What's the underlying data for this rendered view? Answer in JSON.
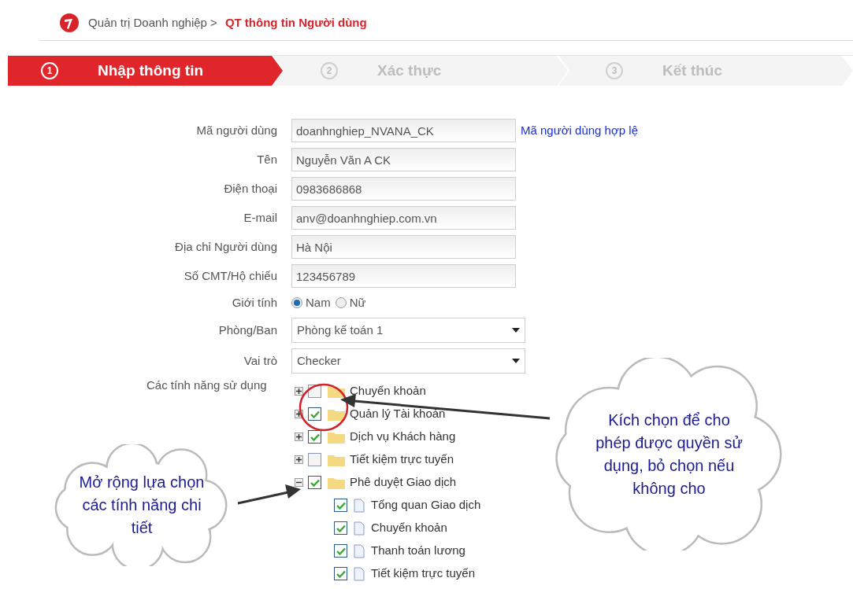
{
  "breadcrumb": {
    "parent": "Quản trị Doanh nghiệp >",
    "current": "QT thông tin Người dùng"
  },
  "steps": [
    {
      "number": "1",
      "label": "Nhập thông tin",
      "selected": true
    },
    {
      "number": "2",
      "label": "Xác thực",
      "selected": false
    },
    {
      "number": "3",
      "label": "Kết thúc",
      "selected": false
    }
  ],
  "form": {
    "fields": [
      {
        "kind": "text",
        "label": "Mã người dùng",
        "value": "doanhnghiep_NVANA_CK",
        "note": "Mã người dùng hợp lệ"
      },
      {
        "kind": "text",
        "label": "Tên",
        "value": "Nguyễn Văn A CK"
      },
      {
        "kind": "text",
        "label": "Điện thoại",
        "value": "0983686868"
      },
      {
        "kind": "text",
        "label": "E-mail",
        "value": "anv@doanhnghiep.com.vn"
      },
      {
        "kind": "text",
        "label": "Địa chỉ Người dùng",
        "value": "Hà Nội"
      },
      {
        "kind": "text",
        "label": "Số CMT/Hộ chiếu",
        "value": "123456789"
      },
      {
        "kind": "radio",
        "label": "Giới tính",
        "options": [
          {
            "label": "Nam",
            "selected": true
          },
          {
            "label": "Nữ",
            "selected": false
          }
        ]
      },
      {
        "kind": "select",
        "label": "Phòng/Ban",
        "value": "Phòng kế toán 1"
      },
      {
        "kind": "select",
        "label": "Vai trò",
        "value": "Checker"
      }
    ],
    "features_label": "Các tính năng sử dụng",
    "features": [
      {
        "label": "Chuyển khoản",
        "checked": false,
        "expanded": false
      },
      {
        "label": "Quản lý Tài khoản",
        "checked": true,
        "expanded": false
      },
      {
        "label": "Dịch vụ Khách hàng",
        "checked": true,
        "expanded": false
      },
      {
        "label": "Tiết kiệm trực tuyến",
        "checked": false,
        "expanded": false
      },
      {
        "label": "Phê duyệt Giao dịch",
        "checked": true,
        "expanded": true,
        "children": [
          {
            "label": "Tổng quan Giao dịch",
            "checked": true
          },
          {
            "label": "Chuyển khoản",
            "checked": true
          },
          {
            "label": "Thanh toán lương",
            "checked": true
          },
          {
            "label": "Tiết kiệm trực tuyến",
            "checked": true
          }
        ]
      }
    ]
  },
  "callouts": [
    {
      "kind": "left",
      "text": "Mở rộng lựa chọn các tính năng chi tiết"
    },
    {
      "kind": "right",
      "text": "Kích chọn để cho phép được quyền sử dụng, bỏ chọn nếu không cho"
    }
  ]
}
